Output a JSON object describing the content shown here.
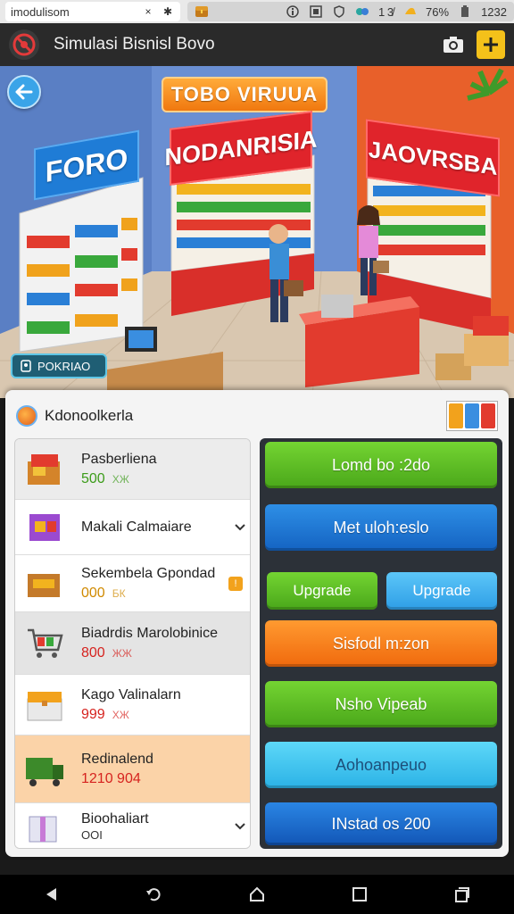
{
  "status_bar": {
    "tab_title": "imodulisom",
    "tab_close": "×",
    "tab_extra": "✱",
    "signal": "1 3̸",
    "battery": "76%",
    "time": "1232"
  },
  "app_bar": {
    "title": "Simulasi Bisnisl Bovo"
  },
  "scene": {
    "badge": "TOBO VIRUUA",
    "sign_left": "FORO",
    "sign_middle": "NODANRISIA",
    "sign_right": "JAOVRSBA",
    "tag_label": "POKRIAO"
  },
  "panel": {
    "title": "Kdonoolkerla",
    "items": [
      {
        "name": "Pasberliena",
        "price": "500",
        "sub": "ХЖ",
        "price_color": "#3c9c1a"
      },
      {
        "name": "Makali Calmaiare",
        "price": "",
        "sub": "",
        "price_color": "#333333"
      },
      {
        "name": "Sekembela Gpondad",
        "price": "000",
        "sub": "БК",
        "price_color": "#d08a00"
      },
      {
        "name": "Biadrdis Marolobinice",
        "price": "800",
        "sub": "ЖЖ",
        "price_color": "#d6231f"
      },
      {
        "name": "Kago Valinalarn",
        "price": "999",
        "sub": "ХЖ",
        "price_color": "#d6231f"
      },
      {
        "name": "Redinalend",
        "price": "1210 904",
        "sub": "",
        "price_color": "#d6231f"
      },
      {
        "name": "Bioohaliart",
        "price": "OOI",
        "sub": "",
        "price_color": "#333333"
      }
    ],
    "buttons": {
      "b1": "Lomd bo :2do",
      "b2": "Met uloh:eslo",
      "upgrade_left": "Upgrade",
      "upgrade_right": "Upgrade",
      "b4": "Sisfodl m:zon",
      "b5": "Nsho Vipeab",
      "b6": "Aohoanpeuo",
      "b7": "INstad os 200"
    }
  },
  "colors": {
    "accent_orange": "#f0780f",
    "accent_green": "#4aa71a",
    "accent_blue": "#1463c2",
    "add_button": "#f4c11a"
  }
}
